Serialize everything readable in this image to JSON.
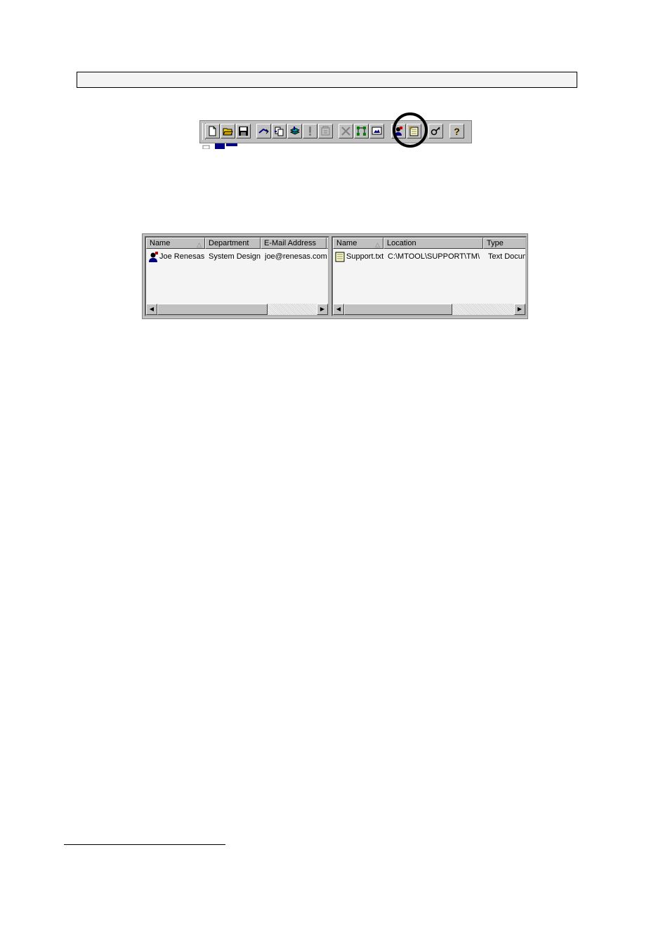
{
  "toolbar": {
    "buttons": [
      {
        "icon": "new-document-icon"
      },
      {
        "icon": "open-folder-icon"
      },
      {
        "icon": "save-disk-icon"
      },
      {
        "icon": "link-arrow-icon"
      },
      {
        "icon": "copy-pages-icon"
      },
      {
        "icon": "stack-layers-icon"
      },
      {
        "icon": "exclamation-icon"
      },
      {
        "icon": "properties-icon"
      },
      {
        "icon": "delete-x-icon"
      },
      {
        "icon": "tree-network-icon"
      },
      {
        "icon": "view-screen-icon"
      },
      {
        "icon": "contact-person-icon"
      },
      {
        "icon": "notepad-icon"
      },
      {
        "icon": "search-key-icon"
      },
      {
        "icon": "help-question-icon"
      }
    ]
  },
  "contacts_pane": {
    "columns": [
      "Name",
      "Department",
      "E-Mail Address"
    ],
    "rows": [
      {
        "name": "Joe Renesas",
        "department": "System Design",
        "email": "joe@renesas.com"
      }
    ]
  },
  "files_pane": {
    "columns": [
      "Name",
      "Location",
      "Type"
    ],
    "rows": [
      {
        "name": "Support.txt",
        "location": "C:\\MTOOL\\SUPPORT\\TM\\",
        "type": "Text Docum"
      }
    ]
  },
  "colors": {
    "toolbar_face": "#c0c0c0",
    "pane_background": "#f4f4f4",
    "highlight_circle": "#000000"
  }
}
